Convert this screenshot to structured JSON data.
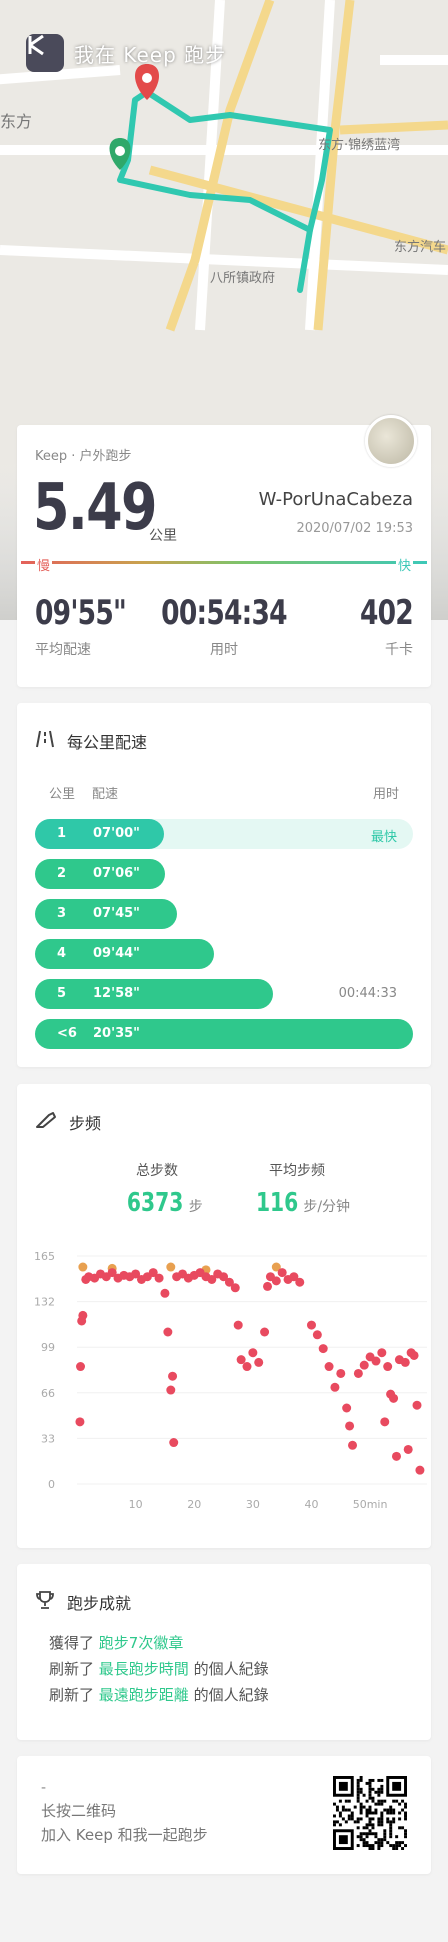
{
  "map": {
    "brand_text": "我在 Keep 跑步",
    "labels": [
      "东方",
      "东方·锦绣蓝湾",
      "东方汽车",
      "八所镇政府"
    ]
  },
  "summary": {
    "source": "Keep · 户外跑步",
    "distance": "5.49",
    "distance_unit": "公里",
    "user": "W-PorUnaCabeza",
    "datetime": "2020/07/02 19:53",
    "slow_label": "慢",
    "fast_label": "快",
    "stats": [
      {
        "value": "09'55\"",
        "label": "平均配速"
      },
      {
        "value": "00:54:34",
        "label": "用时"
      },
      {
        "value": "402",
        "label": "千卡"
      }
    ]
  },
  "pace": {
    "title": "每公里配速",
    "col_km": "公里",
    "col_pace": "配速",
    "col_time": "用时",
    "rows": [
      {
        "km": "1",
        "pace": "07'00\"",
        "seconds": 420,
        "note": "最快",
        "color": "#2fc8a8"
      },
      {
        "km": "2",
        "pace": "07'06\"",
        "seconds": 426,
        "note": "",
        "color": "#2fc88c"
      },
      {
        "km": "3",
        "pace": "07'45\"",
        "seconds": 465,
        "note": "",
        "color": "#2fc88c"
      },
      {
        "km": "4",
        "pace": "09'44\"",
        "seconds": 584,
        "note": "",
        "color": "#2fc88c"
      },
      {
        "km": "5",
        "pace": "12'58\"",
        "seconds": 778,
        "note": "00:44:33",
        "color": "#2fc88c"
      },
      {
        "km": "<6",
        "pace": "20'35\"",
        "seconds": 1235,
        "note": "",
        "color": "#2fc88c"
      }
    ]
  },
  "cadence": {
    "title": "步频",
    "total_label": "总步数",
    "total_value": "6373",
    "total_unit": "步",
    "avg_label": "平均步频",
    "avg_value": "116",
    "avg_unit": "步/分钟",
    "chart_data": {
      "type": "scatter",
      "x_ticks": [
        "10",
        "20",
        "30",
        "40",
        "50min"
      ],
      "y_ticks": [
        "165",
        "132",
        "99",
        "66",
        "33",
        "0"
      ],
      "xlim": [
        0,
        58
      ],
      "ylim": [
        0,
        165
      ],
      "series_colors": [
        "#e84a5f",
        "#e8a050"
      ],
      "points": [
        [
          0.5,
          45
        ],
        [
          0.6,
          85
        ],
        [
          0.8,
          118
        ],
        [
          1,
          122
        ],
        [
          1.5,
          148
        ],
        [
          2,
          150
        ],
        [
          3,
          149
        ],
        [
          4,
          152
        ],
        [
          5,
          150
        ],
        [
          6,
          153
        ],
        [
          7,
          149
        ],
        [
          8,
          151
        ],
        [
          9,
          150
        ],
        [
          10,
          152
        ],
        [
          11,
          148
        ],
        [
          12,
          150
        ],
        [
          13,
          153
        ],
        [
          14,
          149
        ],
        [
          15,
          138
        ],
        [
          15.5,
          110
        ],
        [
          16,
          68
        ],
        [
          16.3,
          78
        ],
        [
          16.5,
          30
        ],
        [
          17,
          150
        ],
        [
          18,
          152
        ],
        [
          19,
          149
        ],
        [
          20,
          151
        ],
        [
          21,
          153
        ],
        [
          22,
          150
        ],
        [
          23,
          148
        ],
        [
          24,
          152
        ],
        [
          25,
          150
        ],
        [
          26,
          146
        ],
        [
          27,
          142
        ],
        [
          27.5,
          115
        ],
        [
          28,
          90
        ],
        [
          29,
          85
        ],
        [
          30,
          95
        ],
        [
          31,
          88
        ],
        [
          32,
          110
        ],
        [
          32.5,
          143
        ],
        [
          33,
          150
        ],
        [
          34,
          147
        ],
        [
          35,
          153
        ],
        [
          36,
          148
        ],
        [
          37,
          150
        ],
        [
          38,
          146
        ],
        [
          40,
          115
        ],
        [
          41,
          108
        ],
        [
          42,
          98
        ],
        [
          43,
          85
        ],
        [
          44,
          70
        ],
        [
          45,
          80
        ],
        [
          46,
          55
        ],
        [
          46.5,
          42
        ],
        [
          47,
          28
        ],
        [
          48,
          80
        ],
        [
          49,
          86
        ],
        [
          50,
          92
        ],
        [
          51,
          89
        ],
        [
          52,
          95
        ],
        [
          53,
          85
        ],
        [
          53.5,
          65
        ],
        [
          54,
          62
        ],
        [
          55,
          90
        ],
        [
          56,
          88
        ],
        [
          57,
          95
        ],
        [
          57.5,
          93
        ],
        [
          58,
          57
        ],
        [
          52.5,
          45
        ],
        [
          54.5,
          20
        ],
        [
          56.5,
          25
        ],
        [
          58.5,
          10
        ]
      ],
      "highlight_points": [
        [
          1,
          157
        ],
        [
          6,
          156
        ],
        [
          16,
          157
        ],
        [
          22,
          155
        ],
        [
          34,
          157
        ]
      ]
    }
  },
  "achievements": {
    "title": "跑步成就",
    "lines": [
      {
        "pre": "獲得了 ",
        "hl": "跑步7次徽章",
        "post": ""
      },
      {
        "pre": "刷新了 ",
        "hl": "最長跑步時間",
        "post": " 的個人紀錄"
      },
      {
        "pre": "刷新了 ",
        "hl": "最遠跑步距離",
        "post": " 的個人紀錄"
      }
    ]
  },
  "share": {
    "dash": "-",
    "line1": "长按二维码",
    "line2": "加入 Keep 和我一起跑步"
  }
}
